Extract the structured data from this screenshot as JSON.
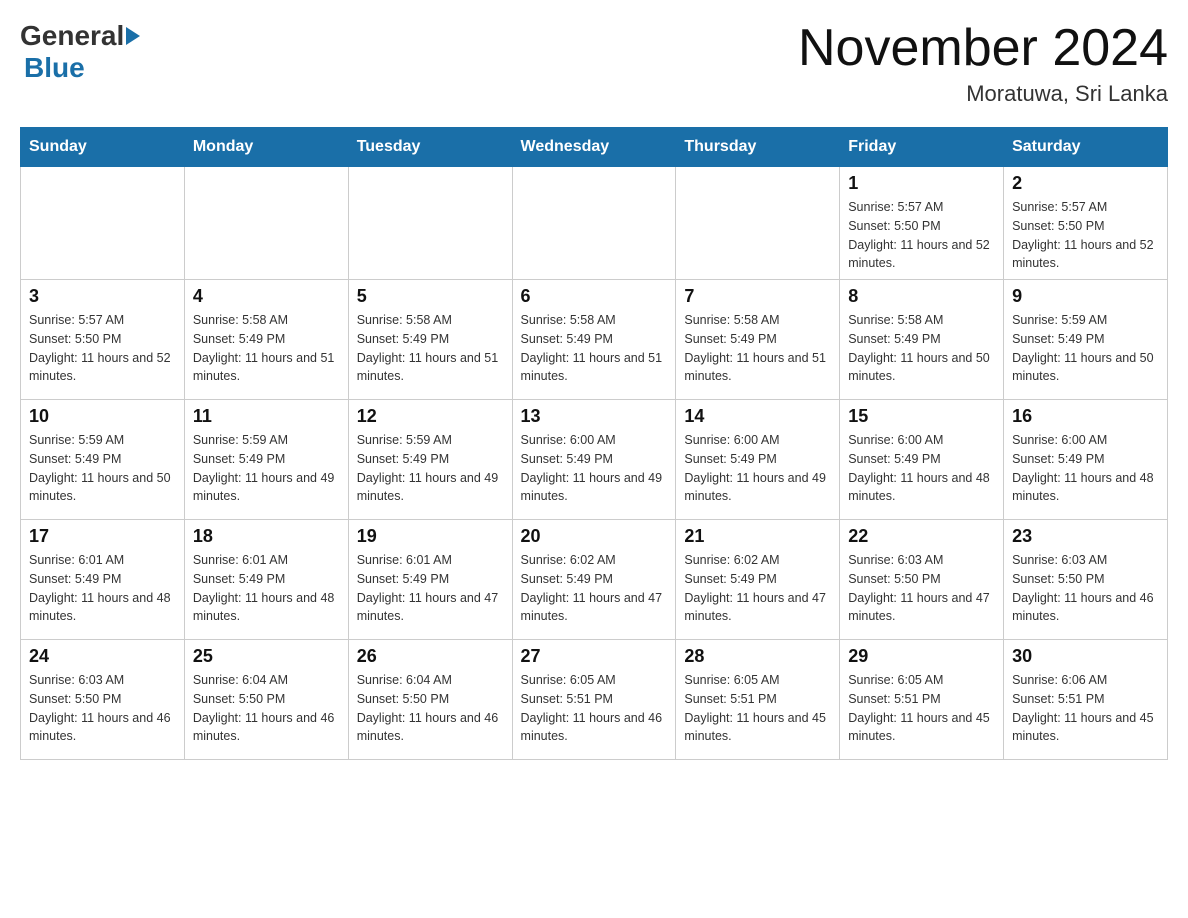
{
  "header": {
    "logo": {
      "general": "General",
      "blue": "Blue"
    },
    "title": "November 2024",
    "location": "Moratuwa, Sri Lanka"
  },
  "weekdays": [
    "Sunday",
    "Monday",
    "Tuesday",
    "Wednesday",
    "Thursday",
    "Friday",
    "Saturday"
  ],
  "weeks": [
    [
      {
        "day": "",
        "info": ""
      },
      {
        "day": "",
        "info": ""
      },
      {
        "day": "",
        "info": ""
      },
      {
        "day": "",
        "info": ""
      },
      {
        "day": "",
        "info": ""
      },
      {
        "day": "1",
        "info": "Sunrise: 5:57 AM\nSunset: 5:50 PM\nDaylight: 11 hours and 52 minutes."
      },
      {
        "day": "2",
        "info": "Sunrise: 5:57 AM\nSunset: 5:50 PM\nDaylight: 11 hours and 52 minutes."
      }
    ],
    [
      {
        "day": "3",
        "info": "Sunrise: 5:57 AM\nSunset: 5:50 PM\nDaylight: 11 hours and 52 minutes."
      },
      {
        "day": "4",
        "info": "Sunrise: 5:58 AM\nSunset: 5:49 PM\nDaylight: 11 hours and 51 minutes."
      },
      {
        "day": "5",
        "info": "Sunrise: 5:58 AM\nSunset: 5:49 PM\nDaylight: 11 hours and 51 minutes."
      },
      {
        "day": "6",
        "info": "Sunrise: 5:58 AM\nSunset: 5:49 PM\nDaylight: 11 hours and 51 minutes."
      },
      {
        "day": "7",
        "info": "Sunrise: 5:58 AM\nSunset: 5:49 PM\nDaylight: 11 hours and 51 minutes."
      },
      {
        "day": "8",
        "info": "Sunrise: 5:58 AM\nSunset: 5:49 PM\nDaylight: 11 hours and 50 minutes."
      },
      {
        "day": "9",
        "info": "Sunrise: 5:59 AM\nSunset: 5:49 PM\nDaylight: 11 hours and 50 minutes."
      }
    ],
    [
      {
        "day": "10",
        "info": "Sunrise: 5:59 AM\nSunset: 5:49 PM\nDaylight: 11 hours and 50 minutes."
      },
      {
        "day": "11",
        "info": "Sunrise: 5:59 AM\nSunset: 5:49 PM\nDaylight: 11 hours and 49 minutes."
      },
      {
        "day": "12",
        "info": "Sunrise: 5:59 AM\nSunset: 5:49 PM\nDaylight: 11 hours and 49 minutes."
      },
      {
        "day": "13",
        "info": "Sunrise: 6:00 AM\nSunset: 5:49 PM\nDaylight: 11 hours and 49 minutes."
      },
      {
        "day": "14",
        "info": "Sunrise: 6:00 AM\nSunset: 5:49 PM\nDaylight: 11 hours and 49 minutes."
      },
      {
        "day": "15",
        "info": "Sunrise: 6:00 AM\nSunset: 5:49 PM\nDaylight: 11 hours and 48 minutes."
      },
      {
        "day": "16",
        "info": "Sunrise: 6:00 AM\nSunset: 5:49 PM\nDaylight: 11 hours and 48 minutes."
      }
    ],
    [
      {
        "day": "17",
        "info": "Sunrise: 6:01 AM\nSunset: 5:49 PM\nDaylight: 11 hours and 48 minutes."
      },
      {
        "day": "18",
        "info": "Sunrise: 6:01 AM\nSunset: 5:49 PM\nDaylight: 11 hours and 48 minutes."
      },
      {
        "day": "19",
        "info": "Sunrise: 6:01 AM\nSunset: 5:49 PM\nDaylight: 11 hours and 47 minutes."
      },
      {
        "day": "20",
        "info": "Sunrise: 6:02 AM\nSunset: 5:49 PM\nDaylight: 11 hours and 47 minutes."
      },
      {
        "day": "21",
        "info": "Sunrise: 6:02 AM\nSunset: 5:49 PM\nDaylight: 11 hours and 47 minutes."
      },
      {
        "day": "22",
        "info": "Sunrise: 6:03 AM\nSunset: 5:50 PM\nDaylight: 11 hours and 47 minutes."
      },
      {
        "day": "23",
        "info": "Sunrise: 6:03 AM\nSunset: 5:50 PM\nDaylight: 11 hours and 46 minutes."
      }
    ],
    [
      {
        "day": "24",
        "info": "Sunrise: 6:03 AM\nSunset: 5:50 PM\nDaylight: 11 hours and 46 minutes."
      },
      {
        "day": "25",
        "info": "Sunrise: 6:04 AM\nSunset: 5:50 PM\nDaylight: 11 hours and 46 minutes."
      },
      {
        "day": "26",
        "info": "Sunrise: 6:04 AM\nSunset: 5:50 PM\nDaylight: 11 hours and 46 minutes."
      },
      {
        "day": "27",
        "info": "Sunrise: 6:05 AM\nSunset: 5:51 PM\nDaylight: 11 hours and 46 minutes."
      },
      {
        "day": "28",
        "info": "Sunrise: 6:05 AM\nSunset: 5:51 PM\nDaylight: 11 hours and 45 minutes."
      },
      {
        "day": "29",
        "info": "Sunrise: 6:05 AM\nSunset: 5:51 PM\nDaylight: 11 hours and 45 minutes."
      },
      {
        "day": "30",
        "info": "Sunrise: 6:06 AM\nSunset: 5:51 PM\nDaylight: 11 hours and 45 minutes."
      }
    ]
  ]
}
